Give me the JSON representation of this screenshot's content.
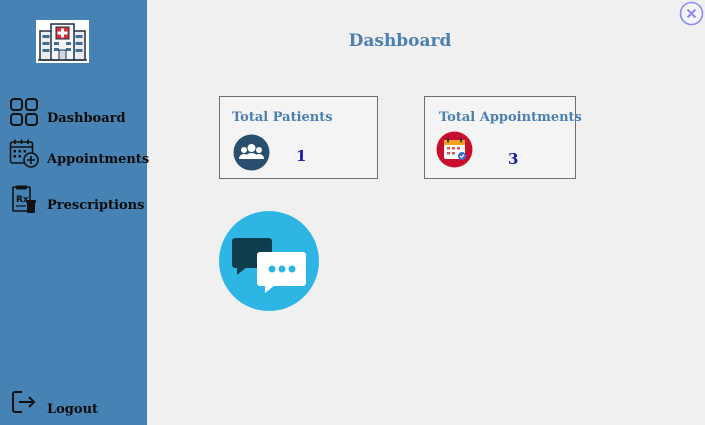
{
  "sidebar": {
    "logo_icon": "hospital-icon",
    "items": [
      {
        "label": "Dashboard",
        "icon": "grid-icon"
      },
      {
        "label": "Appointments",
        "icon": "calendar-add-icon"
      },
      {
        "label": "Prescriptions",
        "icon": "prescription-icon"
      }
    ],
    "logout": {
      "label": "Logout",
      "icon": "logout-icon"
    }
  },
  "header": {
    "title": "Dashboard",
    "close_icon": "close-icon"
  },
  "cards": [
    {
      "title": "Total Patients",
      "value": "1",
      "icon": "patients-icon"
    },
    {
      "title": "Total Appointments",
      "value": "3",
      "icon": "calendar-icon"
    }
  ],
  "chat": {
    "icon": "chat-bubbles-icon"
  },
  "colors": {
    "sidebar": "#4682b4",
    "background": "#f0f0f0",
    "title": "#4a7fb0",
    "card_value": "#1a1aa8",
    "chat_circle": "#2fb5e3"
  }
}
